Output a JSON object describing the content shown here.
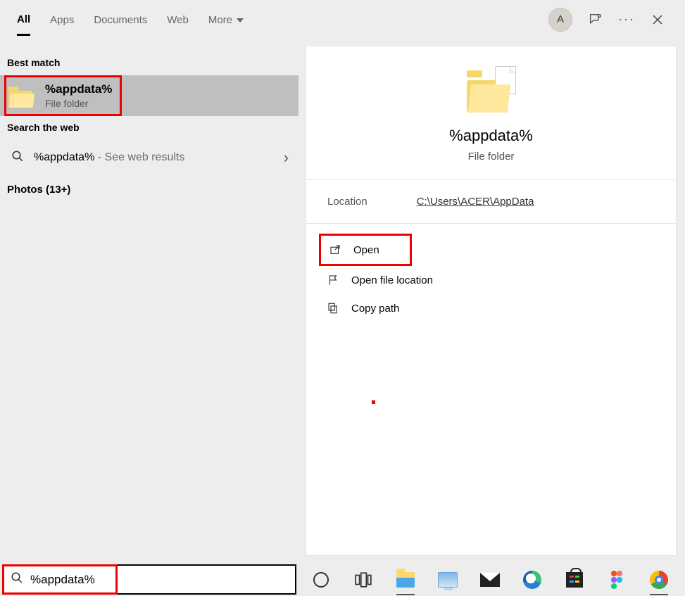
{
  "header": {
    "tabs": {
      "all": "All",
      "apps": "Apps",
      "documents": "Documents",
      "web": "Web",
      "more": "More"
    },
    "avatar_letter": "A"
  },
  "left": {
    "best_match_label": "Best match",
    "result": {
      "title": "%appdata%",
      "subtitle": "File folder"
    },
    "search_web_label": "Search the web",
    "web_result": {
      "query": "%appdata%",
      "suffix": " - See web results"
    },
    "photos_label": "Photos (13+)"
  },
  "preview": {
    "title": "%appdata%",
    "subtitle": "File folder",
    "location_label": "Location",
    "location_value": "C:\\Users\\ACER\\AppData",
    "actions": {
      "open": "Open",
      "open_location": "Open file location",
      "copy_path": "Copy path"
    }
  },
  "search": {
    "value": "%appdata%"
  }
}
